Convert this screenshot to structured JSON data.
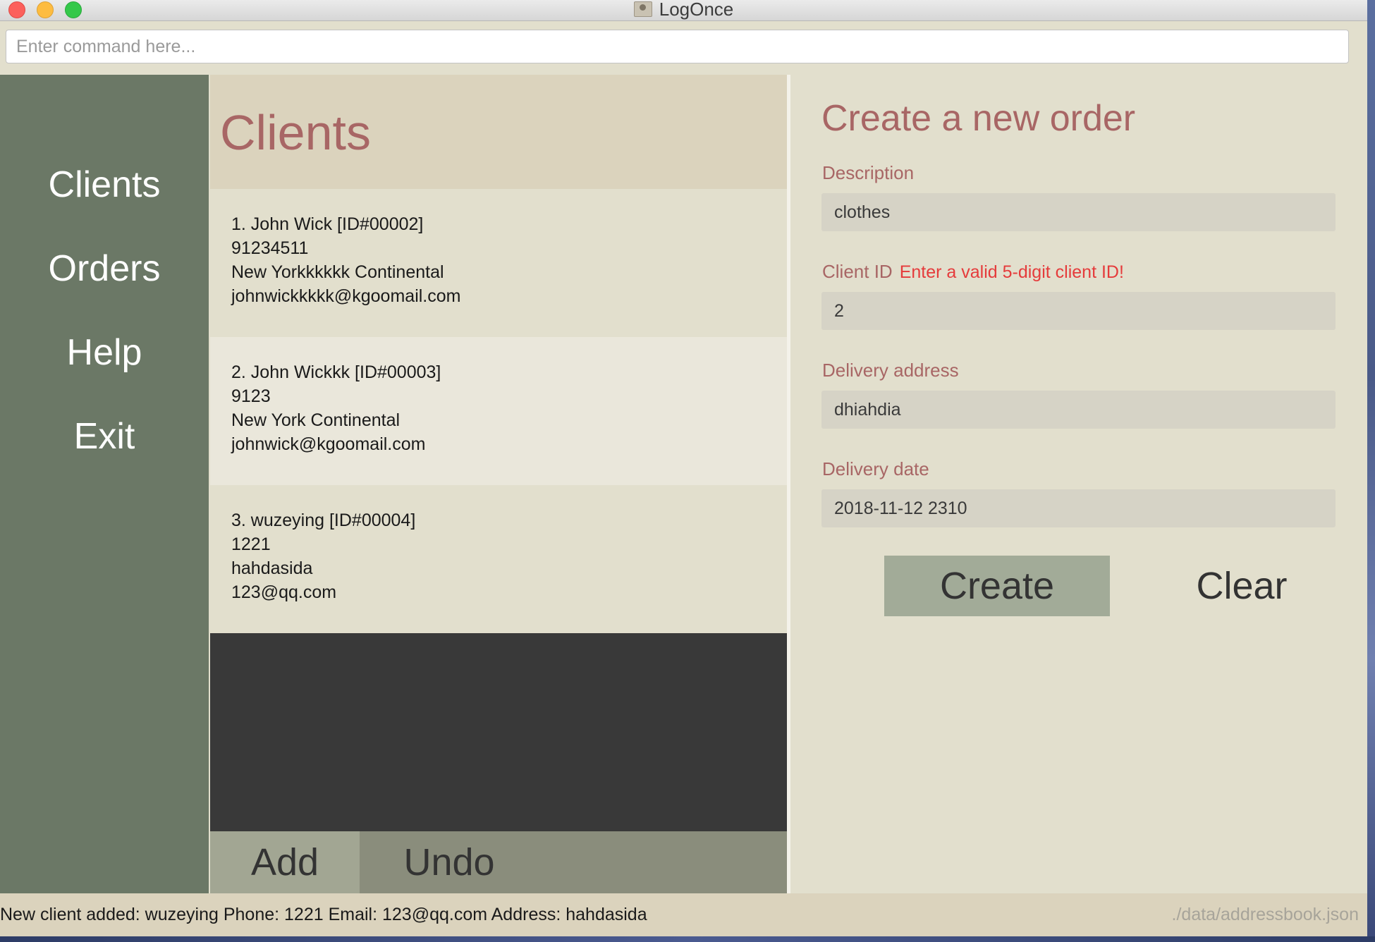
{
  "window": {
    "title": "LogOnce"
  },
  "command": {
    "placeholder": "Enter command here...",
    "value": ""
  },
  "sidebar": {
    "items": [
      {
        "label": "Clients"
      },
      {
        "label": "Orders"
      },
      {
        "label": "Help"
      },
      {
        "label": "Exit"
      }
    ]
  },
  "clients": {
    "title": "Clients",
    "items": [
      {
        "header": "1.  John Wick [ID#00002]",
        "phone": "91234511",
        "address": "New Yorkkkkkk Continental",
        "email": "johnwickkkkk@kgoomail.com"
      },
      {
        "header": "2.  John Wickkk [ID#00003]",
        "phone": "9123",
        "address": "New York Continental",
        "email": "johnwick@kgoomail.com"
      },
      {
        "header": "3.  wuzeying [ID#00004]",
        "phone": "1221",
        "address": "hahdasida",
        "email": "123@qq.com"
      }
    ],
    "add_label": "Add",
    "undo_label": "Undo"
  },
  "order_form": {
    "title": "Create a new order",
    "description": {
      "label": "Description",
      "value": "clothes"
    },
    "client_id": {
      "label": "Client ID",
      "error": "Enter a valid 5-digit client ID!",
      "value": "2"
    },
    "delivery_address": {
      "label": "Delivery address",
      "value": "dhiahdia"
    },
    "delivery_date": {
      "label": "Delivery date",
      "value": "2018-11-12 2310"
    },
    "create_label": "Create",
    "clear_label": "Clear"
  },
  "status": {
    "message": "New client added: wuzeying Phone: 1221 Email: 123@qq.com Address: hahdasida",
    "path": "./data/addressbook.json"
  },
  "colors": {
    "sidebar": "#6b7866",
    "accent_text": "#a86665",
    "error": "#e53b3b",
    "panel_bg": "#e2dfcd",
    "list_empty": "#393939"
  }
}
